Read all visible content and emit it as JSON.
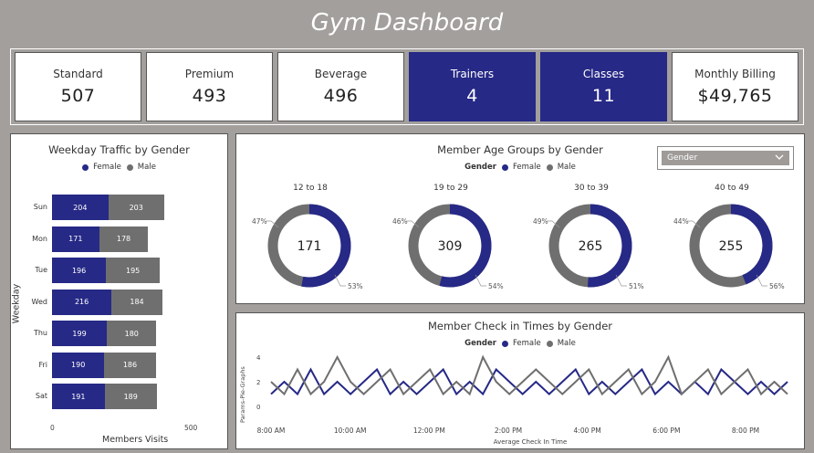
{
  "title": "Gym Dashboard",
  "kpis": [
    {
      "label": "Standard",
      "value": "507",
      "dark": false
    },
    {
      "label": "Premium",
      "value": "493",
      "dark": false
    },
    {
      "label": "Beverage",
      "value": "496",
      "dark": false
    },
    {
      "label": "Trainers",
      "value": "4",
      "dark": true
    },
    {
      "label": "Classes",
      "value": "11",
      "dark": true
    },
    {
      "label": "Monthly Billing",
      "value": "$49,765",
      "dark": false
    }
  ],
  "colors": {
    "female": "#262986",
    "male": "#6f6f6f",
    "kpi_dark": "#262986",
    "background": "#a29f9d"
  },
  "weekday": {
    "title": "Weekday Traffic by Gender",
    "legend": {
      "female": "Female",
      "male": "Male"
    },
    "y_title": "Weekday",
    "x_title": "Members Visits",
    "x_ticks": [
      "0",
      "500"
    ],
    "days": [
      {
        "day": "Sun",
        "female": 204,
        "male": 203
      },
      {
        "day": "Mon",
        "female": 171,
        "male": 178
      },
      {
        "day": "Tue",
        "female": 196,
        "male": 195
      },
      {
        "day": "Wed",
        "female": 216,
        "male": 184
      },
      {
        "day": "Thu",
        "female": 199,
        "male": 180
      },
      {
        "day": "Fri",
        "female": 190,
        "male": 186
      },
      {
        "day": "Sat",
        "female": 191,
        "male": 189
      }
    ]
  },
  "age": {
    "title": "Member Age Groups by Gender",
    "legend": {
      "label": "Gender",
      "female": "Female",
      "male": "Male"
    },
    "dropdown": {
      "selected": "Gender"
    },
    "groups": [
      {
        "label": "12 to 18",
        "total": "171",
        "female_pct": 53,
        "male_pct": 47,
        "female_label": "53%",
        "male_label": "47%"
      },
      {
        "label": "19 to 29",
        "total": "309",
        "female_pct": 54,
        "male_pct": 46,
        "female_label": "54%",
        "male_label": "46%"
      },
      {
        "label": "30 to 39",
        "total": "265",
        "female_pct": 51,
        "male_pct": 49,
        "female_label": "51%",
        "male_label": "49%"
      },
      {
        "label": "40 to 49",
        "total": "255",
        "female_pct": 44,
        "male_pct": 56,
        "female_label": "",
        "male_label": "56%",
        "other_label": "44%"
      }
    ]
  },
  "checkin": {
    "title": "Member Check in Times by Gender",
    "legend": {
      "label": "Gender",
      "female": "Female",
      "male": "Male"
    },
    "y_title": "Params-Pie-Graphs",
    "x_title": "Average Check In Time",
    "y_ticks": [
      "0",
      "2",
      "4"
    ],
    "x_ticks": [
      "8:00 AM",
      "10:00 AM",
      "12:00 PM",
      "2:00 PM",
      "4:00 PM",
      "6:00 PM",
      "8:00 PM"
    ],
    "chart_data": {
      "type": "line",
      "ylim": [
        0,
        4
      ],
      "x": [
        "8:00 AM",
        "8:20 AM",
        "8:40 AM",
        "9:00 AM",
        "9:20 AM",
        "9:40 AM",
        "10:00 AM",
        "10:20 AM",
        "10:40 AM",
        "11:00 AM",
        "11:20 AM",
        "11:40 AM",
        "12:00 PM",
        "12:20 PM",
        "12:40 PM",
        "1:00 PM",
        "1:20 PM",
        "1:40 PM",
        "2:00 PM",
        "2:20 PM",
        "2:40 PM",
        "3:00 PM",
        "3:20 PM",
        "3:40 PM",
        "4:00 PM",
        "4:20 PM",
        "4:40 PM",
        "5:00 PM",
        "5:20 PM",
        "5:40 PM",
        "6:00 PM",
        "6:20 PM",
        "6:40 PM",
        "7:00 PM",
        "7:20 PM",
        "7:40 PM",
        "8:00 PM",
        "8:20 PM",
        "8:40 PM",
        "9:00 PM"
      ],
      "series": [
        {
          "name": "Female",
          "values": [
            1,
            2,
            1,
            3,
            1,
            2,
            1,
            2,
            3,
            1,
            2,
            1,
            2,
            3,
            1,
            2,
            1,
            3,
            2,
            1,
            2,
            1,
            2,
            3,
            1,
            2,
            1,
            2,
            3,
            1,
            2,
            1,
            2,
            1,
            3,
            2,
            1,
            2,
            1,
            2
          ]
        },
        {
          "name": "Male",
          "values": [
            2,
            1,
            3,
            1,
            2,
            4,
            2,
            1,
            2,
            3,
            1,
            2,
            3,
            1,
            2,
            1,
            4,
            2,
            1,
            2,
            3,
            2,
            1,
            2,
            3,
            1,
            2,
            3,
            1,
            2,
            4,
            1,
            2,
            3,
            1,
            2,
            3,
            1,
            2,
            1
          ]
        }
      ]
    }
  }
}
